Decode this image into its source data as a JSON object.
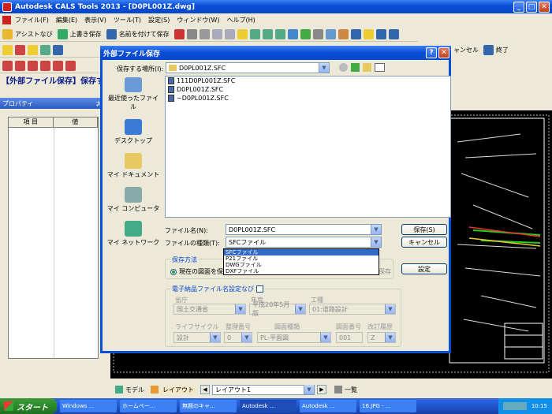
{
  "window": {
    "title": "Autodesk CALS Tools 2013 - [D0PL001Z.dwg]"
  },
  "menu": [
    "ファイル(F)",
    "編集(E)",
    "表示(V)",
    "ツール(T)",
    "設定(S)",
    "ウィンドウ(W)",
    "ヘルプ(H)"
  ],
  "toolbar1": {
    "assist": "アシストなび",
    "overwrite": "上書き保存",
    "saveas": "名前を付けて保存"
  },
  "toolbar2": {
    "cancel": "ャンセル",
    "exit": "終了"
  },
  "heading": "【外部ファイル保存】保存す",
  "properties": {
    "title": "プロパティ",
    "col_item": "項 目",
    "col_value": "値"
  },
  "dialog": {
    "title": "外部ファイル保存",
    "save_in_label": "保存する場所(I):",
    "save_in_value": "D0PL001Z.SFC",
    "places": [
      "最近使ったファイル",
      "デスクトップ",
      "マイ ドキュメント",
      "マイ コンピュータ",
      "マイ ネットワーク"
    ],
    "files": [
      "111D0PL001Z.SFC",
      "D0PL001Z.SFC",
      "~D0PL001Z.SFC"
    ],
    "filename_label": "ファイル名(N):",
    "filename_value": "D0PL001Z.SFC",
    "filetype_label": "ファイルの種類(T):",
    "filetype_value": "SFCファイル",
    "filetype_options": [
      "SFCファイル",
      "P21ファイル",
      "DWGファイル",
      "DXFファイル"
    ],
    "save_button": "保存(S)",
    "cancel_button": "キャンセル",
    "method_label": "保存方法",
    "method_option": "現在の図面を保存",
    "method_option2": "保存",
    "setting_button": "設定",
    "naming_label": "電子納品ファイル名設定なび",
    "ministry_label": "省庁",
    "ministry_value": "国土交通省",
    "year_label": "年度",
    "year_value": "平成20年5月版",
    "work_label": "工種",
    "work_value": "01:道路設計",
    "lifecycle_label": "ライフサイクル",
    "lifecycle_value": "設計",
    "seq_label": "整理番号",
    "seq_value": "0",
    "drawtype_label": "図面種類",
    "drawtype_value": "PL-平面図",
    "drawno_label": "図面番号",
    "drawno_value": "001",
    "revision_label": "改訂履歴",
    "revision_value": "Z"
  },
  "bottom": {
    "model": "モデル",
    "layout": "レイアウト",
    "layout_select": "レイアウト1",
    "list": "一覧"
  },
  "taskbar": {
    "start": "スタート",
    "tasks": [
      "Windows ...",
      "ホームペー...",
      "無題のキャ...",
      "Autodesk ...",
      "Autodesk ...",
      "16.JPG - ..."
    ],
    "time": "10:15"
  }
}
